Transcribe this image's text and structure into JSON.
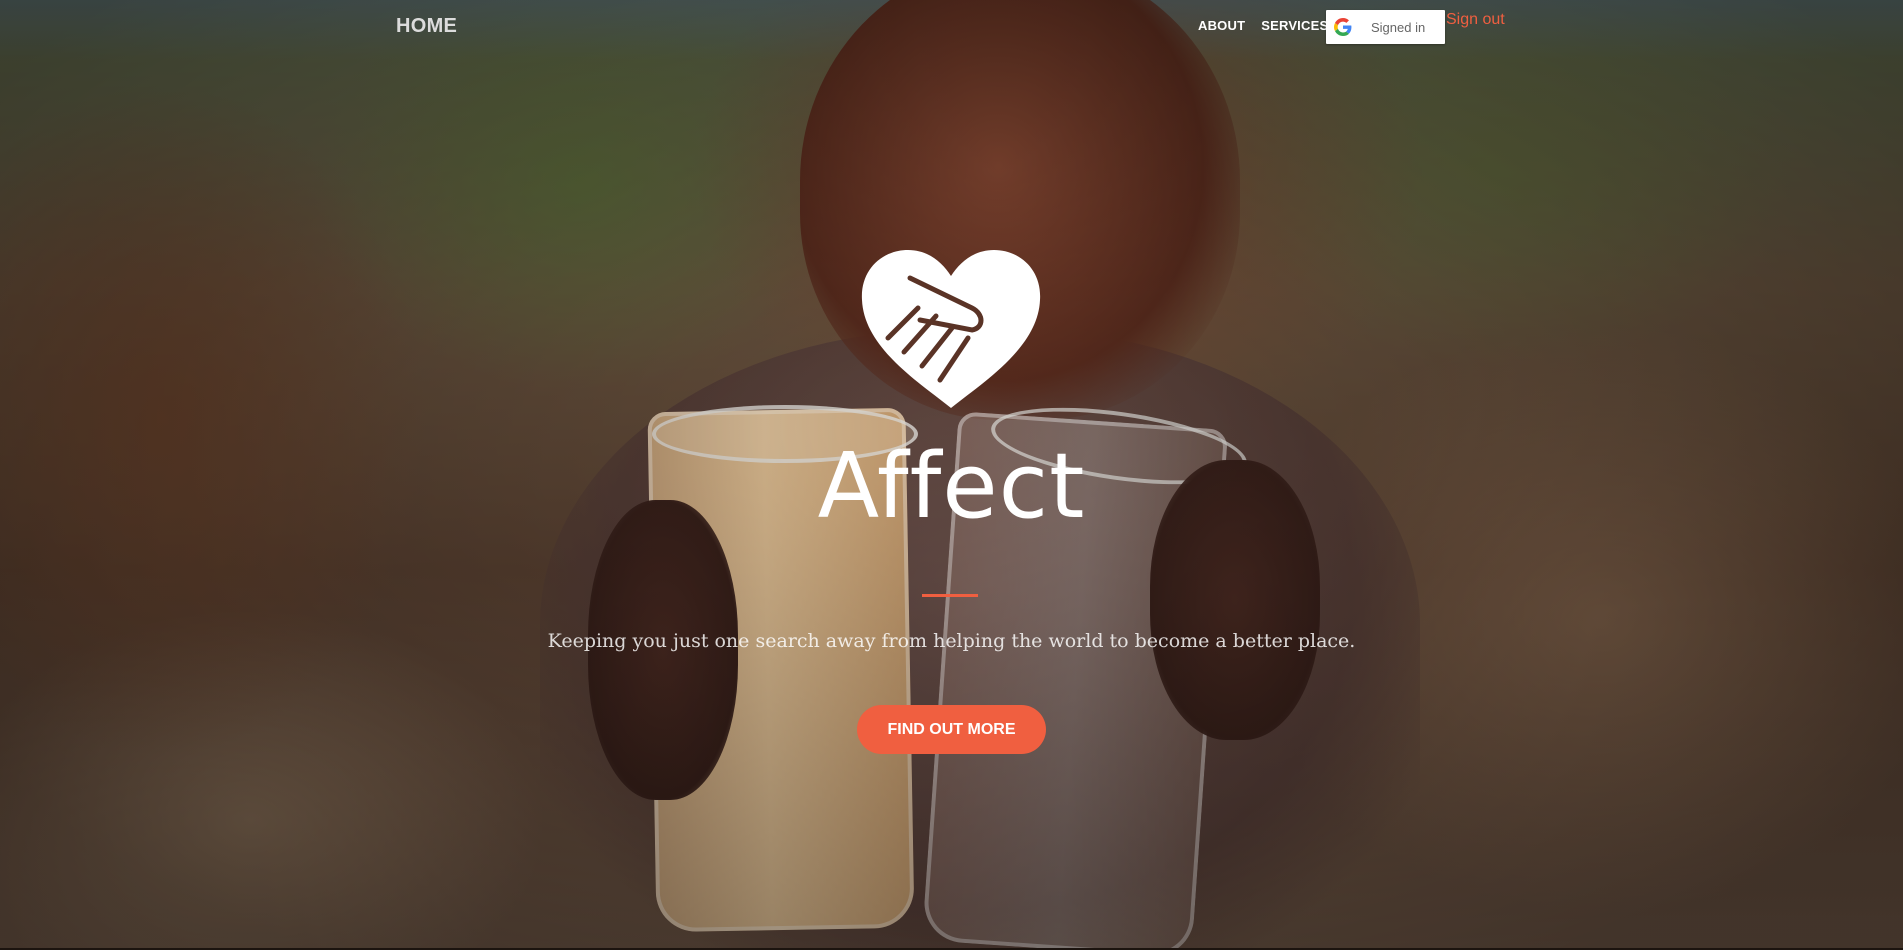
{
  "nav": {
    "brand": "HOME",
    "links": [
      {
        "label": "ABOUT"
      },
      {
        "label": "SERVICES"
      }
    ],
    "google_button": {
      "label": "Signed in",
      "icon": "google-g-icon"
    },
    "signout_label": "Sign out"
  },
  "hero": {
    "logo_icon": "heart-handshake-icon",
    "title": "Affect",
    "subtitle": "Keeping you just one search away from helping the world to become a better place.",
    "cta_label": "FIND OUT MORE",
    "background": "photo-child-holding-two-glasses-of-water"
  },
  "colors": {
    "accent": "#f05f40",
    "text_light": "#ffffff"
  }
}
